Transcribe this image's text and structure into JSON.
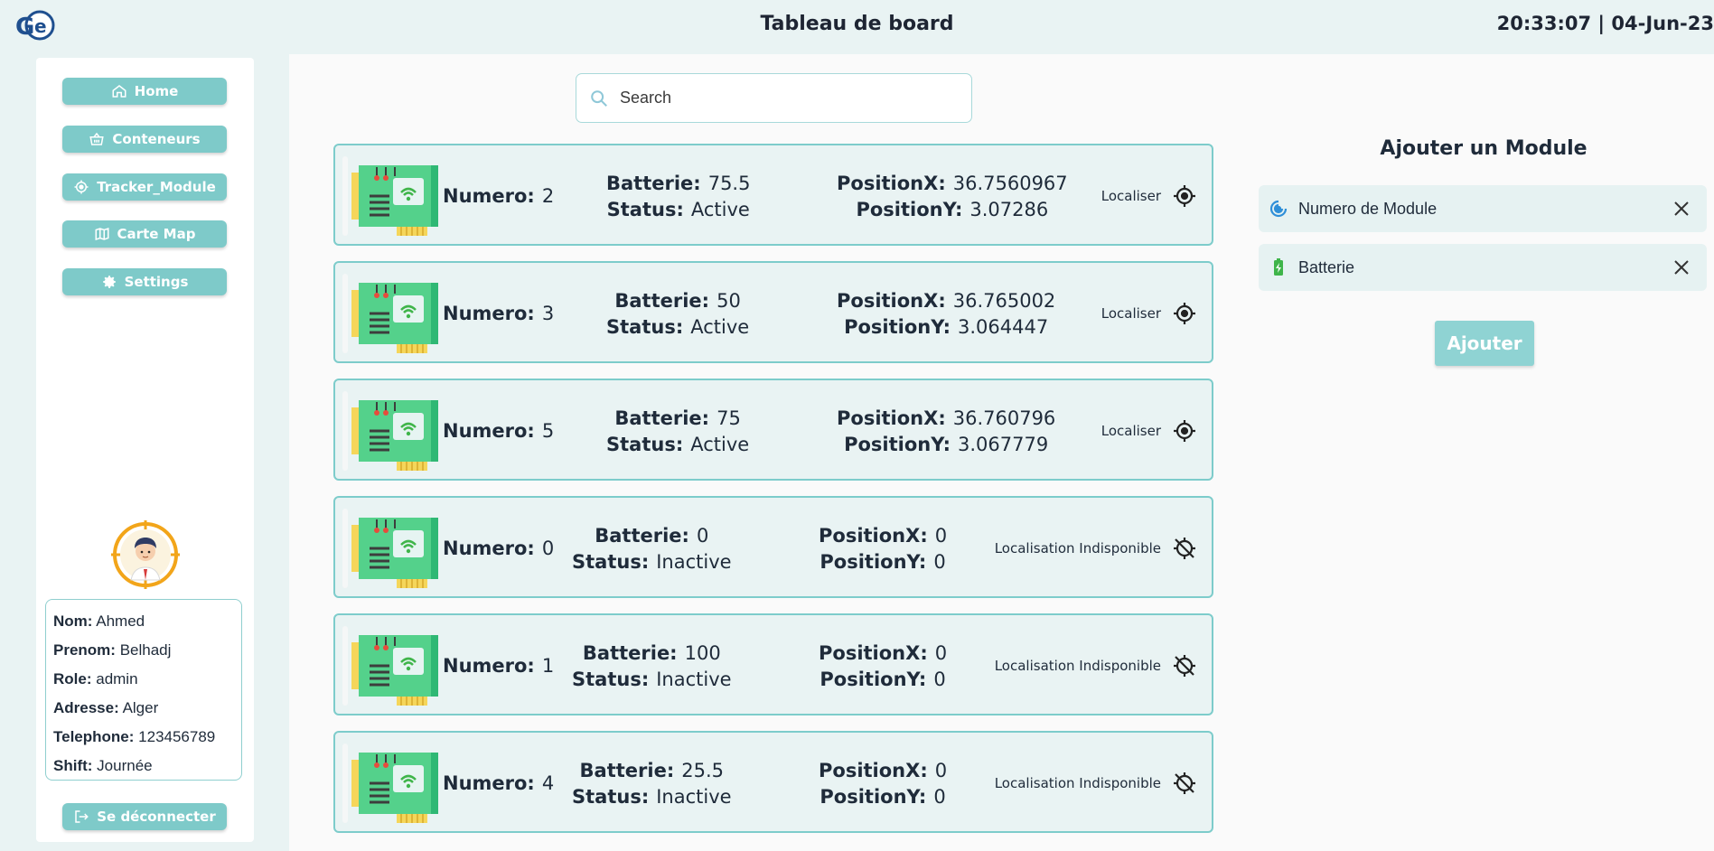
{
  "header": {
    "title": "Tableau de board",
    "clock": "20:33:07 | 04-Jun-23"
  },
  "sidebar": {
    "nav": [
      {
        "label": "Home",
        "icon": "home-icon"
      },
      {
        "label": "Conteneurs",
        "icon": "basket-icon"
      },
      {
        "label": "Tracker_Module",
        "icon": "target-icon"
      },
      {
        "label": "Carte Map",
        "icon": "map-icon"
      },
      {
        "label": "Settings",
        "icon": "gear-icon"
      }
    ],
    "user": {
      "nom_label": "Nom:",
      "nom": "Ahmed",
      "prenom_label": "Prenom:",
      "prenom": "Belhadj",
      "role_label": "Role:",
      "role": "admin",
      "adresse_label": "Adresse:",
      "adresse": "Alger",
      "telephone_label": "Telephone:",
      "telephone": "123456789",
      "shift_label": "Shift:",
      "shift": "Journée"
    },
    "logout_label": "Se déconnecter"
  },
  "search": {
    "placeholder": "Search"
  },
  "labels": {
    "numero": "Numero:",
    "batterie": "Batterie:",
    "status": "Status:",
    "posx": "PositionX:",
    "posy": "PositionY:"
  },
  "modules": [
    {
      "numero": "2",
      "batterie": "75.5",
      "status": "Active",
      "posx": "36.7560967",
      "posy": "3.07286",
      "loc": "Localiser",
      "locatable": true
    },
    {
      "numero": "3",
      "batterie": "50",
      "status": "Active",
      "posx": "36.765002",
      "posy": "3.064447",
      "loc": "Localiser",
      "locatable": true
    },
    {
      "numero": "5",
      "batterie": "75",
      "status": "Active",
      "posx": "36.760796",
      "posy": "3.067779",
      "loc": "Localiser",
      "locatable": true
    },
    {
      "numero": "0",
      "batterie": "0",
      "status": "Inactive",
      "posx": "0",
      "posy": "0",
      "loc": "Localisation Indisponible",
      "locatable": false
    },
    {
      "numero": "1",
      "batterie": "100",
      "status": "Inactive",
      "posx": "0",
      "posy": "0",
      "loc": "Localisation Indisponible",
      "locatable": false
    },
    {
      "numero": "4",
      "batterie": "25.5",
      "status": "Inactive",
      "posx": "0",
      "posy": "0",
      "loc": "Localisation Indisponible",
      "locatable": false
    }
  ],
  "add_panel": {
    "title": "Ajouter un Module",
    "field_module": "Numero de Module",
    "field_batterie": "Batterie",
    "submit": "Ajouter"
  },
  "colors": {
    "accent": "#7ecac9",
    "card_border": "#7dcccb",
    "background": "#e9f3f3"
  }
}
